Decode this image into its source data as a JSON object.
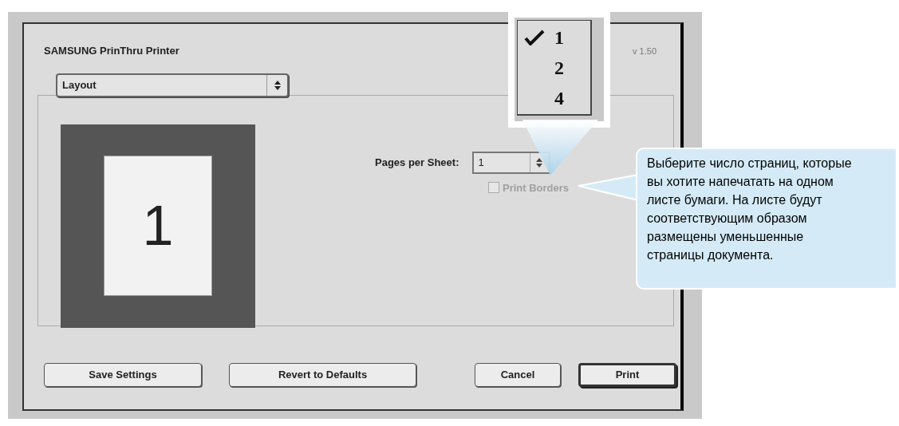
{
  "dialog": {
    "title": "SAMSUNG PrinThru Printer",
    "version": "v 1.50",
    "panel_menu": {
      "value": "Layout"
    },
    "preview": {
      "page_number": "1"
    },
    "pages_per_sheet": {
      "label": "Pages per Sheet:",
      "value": "1"
    },
    "print_borders": {
      "label": "Print Borders",
      "checked": false,
      "disabled": true
    },
    "buttons": [
      {
        "label": "Save Settings",
        "default": false
      },
      {
        "label": "Revert to Defaults",
        "default": false
      },
      {
        "label": "Cancel",
        "default": false
      },
      {
        "label": "Print",
        "default": true
      }
    ]
  },
  "popup_menu": {
    "items": [
      {
        "label": "1",
        "selected": true
      },
      {
        "label": "2",
        "selected": false
      },
      {
        "label": "4",
        "selected": false
      }
    ]
  },
  "callout": {
    "text": "Выберите число страниц, которые вы хотите напечатать на одном листе бумаги. На листе будут соответствующим образом размещены уменьшенные страницы документа."
  }
}
